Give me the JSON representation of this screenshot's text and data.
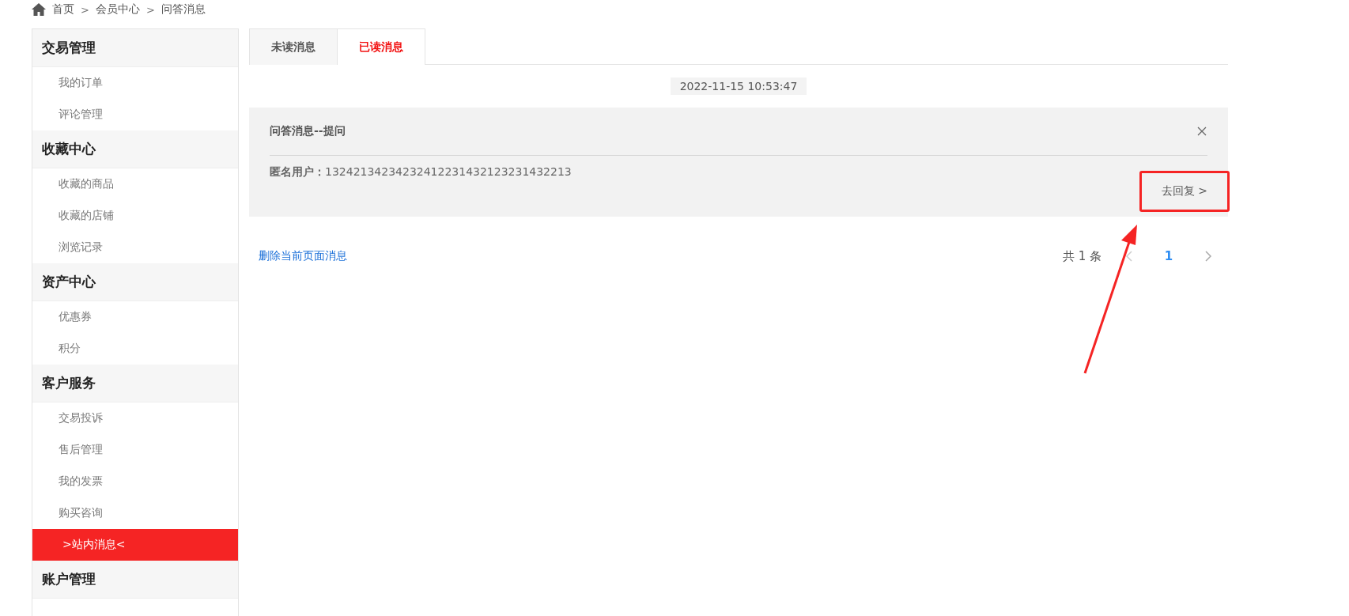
{
  "breadcrumb": [
    {
      "label": "首页"
    },
    {
      "separator": ">",
      "label": "会员中心"
    },
    {
      "separator": ">",
      "label": "问答消息"
    }
  ],
  "sidebar": {
    "sections": [
      {
        "title": "交易管理",
        "items": [
          {
            "label": "我的订单",
            "selected": false
          },
          {
            "label": "评论管理",
            "selected": false
          }
        ]
      },
      {
        "title": "收藏中心",
        "items": [
          {
            "label": "收藏的商品",
            "selected": false
          },
          {
            "label": "收藏的店铺",
            "selected": false
          },
          {
            "label": "浏览记录",
            "selected": false
          }
        ]
      },
      {
        "title": "资产中心",
        "items": [
          {
            "label": "优惠券",
            "selected": false
          },
          {
            "label": "积分",
            "selected": false
          }
        ]
      },
      {
        "title": "客户服务",
        "items": [
          {
            "label": "交易投诉",
            "selected": false
          },
          {
            "label": "售后管理",
            "selected": false
          },
          {
            "label": "我的发票",
            "selected": false
          },
          {
            "label": "购买咨询",
            "selected": false
          },
          {
            "label": ">站内消息<",
            "selected": true
          }
        ]
      },
      {
        "title": "账户管理"
      }
    ]
  },
  "tabs": [
    {
      "label": "未读消息",
      "selected": false
    },
    {
      "label": "已读消息",
      "selected": true
    }
  ],
  "messages": [
    {
      "timestamp": "2022-11-15 10:53:47",
      "title": "问答消息--提问",
      "user_label": "匿名用户：",
      "user_value": "13242134234232412231432123231432213",
      "reply_button": "去回复 >"
    }
  ],
  "footer": {
    "delete_link": "删除当前页面消息",
    "pagination": {
      "total": "共 1 条",
      "pages": [
        {
          "label": "1",
          "selected": true
        }
      ]
    }
  }
}
